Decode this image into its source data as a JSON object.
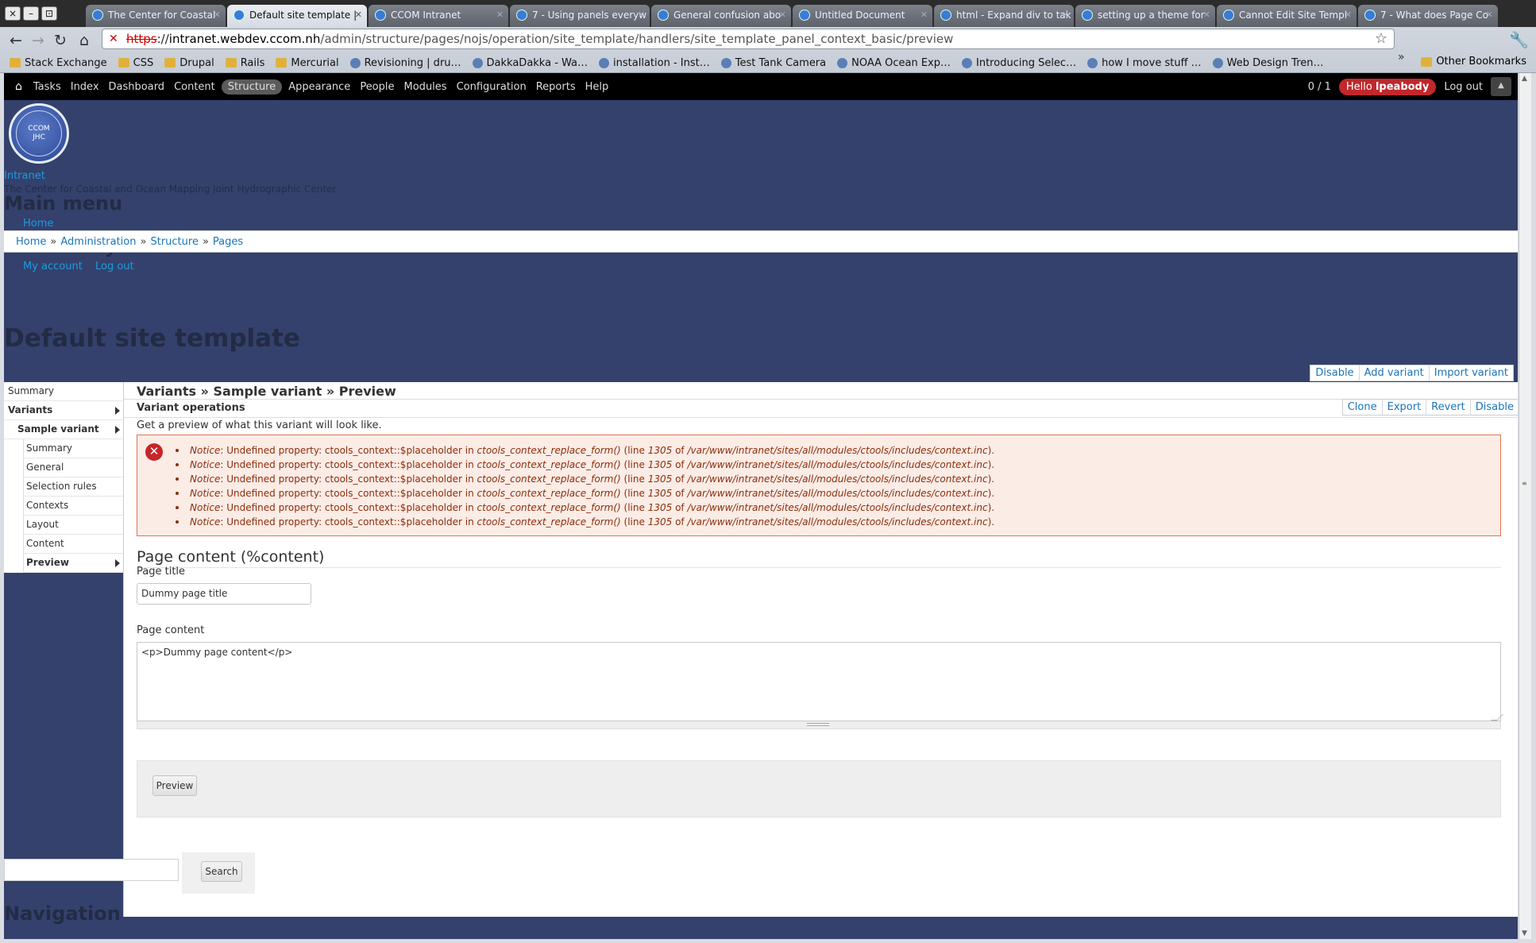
{
  "window": {
    "close": "×",
    "minimize": "–",
    "maximize": "⊡"
  },
  "tabs": [
    {
      "label": "The Center for Coastal",
      "active": false
    },
    {
      "label": "Default site template |",
      "active": true
    },
    {
      "label": "CCOM Intranet",
      "active": false
    },
    {
      "label": "7 - Using panels everyw",
      "active": false
    },
    {
      "label": "General confusion abo",
      "active": false
    },
    {
      "label": "Untitled Document",
      "active": false
    },
    {
      "label": "html - Expand div to tak",
      "active": false
    },
    {
      "label": "setting up a theme for",
      "active": false
    },
    {
      "label": "Cannot Edit Site Templ",
      "active": false
    },
    {
      "label": "7 - What does Page Co",
      "active": false
    }
  ],
  "address": {
    "scheme": "https",
    "domain": "intranet.webdev.ccom.nh",
    "path": "/admin/structure/pages/nojs/operation/site_template/handlers/site_template_panel_context_basic/preview"
  },
  "bookmarks": [
    "Stack Exchange",
    "CSS",
    "Drupal",
    "Rails",
    "Mercurial",
    "Revisioning | dru…",
    "DakkaDakka - Wa…",
    "installation - Inst…",
    "Test Tank Camera",
    "NOAA Ocean Exp…",
    "Introducing Selec…",
    "how I move stuff …",
    "Web Design Tren…"
  ],
  "bookmarks_other": "Other Bookmarks",
  "toolbar": {
    "items": [
      "Tasks",
      "Index",
      "Dashboard",
      "Content",
      "Structure",
      "Appearance",
      "People",
      "Modules",
      "Configuration",
      "Reports",
      "Help"
    ],
    "active": "Structure",
    "counter": "0 / 1",
    "hello_prefix": "Hello",
    "hello_user": "lpeabody",
    "logout": "Log out"
  },
  "header": {
    "logo_text_1": "CCOM",
    "logo_text_2": "JHC",
    "site_name": "Intranet",
    "slogan": "The Center for Coastal and Ocean Mapping Joint Hydrographic Center",
    "main_menu_heading": "Main menu",
    "main_menu_items": [
      "Home"
    ],
    "secondary_menu_heading": "Secondary menu",
    "secondary_menu_items": [
      "My account",
      "Log out"
    ]
  },
  "breadcrumb": [
    "Home",
    "Administration",
    "Structure",
    "Pages"
  ],
  "page_title": "Default site template",
  "top_operations": [
    "Disable",
    "Add variant",
    "Import variant"
  ],
  "vtabs": [
    {
      "label": "Summary",
      "level": 1,
      "bold": false,
      "arrow": false
    },
    {
      "label": "Variants",
      "level": 1,
      "bold": true,
      "arrow": true
    },
    {
      "label": "Sample variant",
      "level": 2,
      "bold": true,
      "arrow": true
    },
    {
      "label": "Summary",
      "level": 3,
      "bold": false,
      "arrow": false
    },
    {
      "label": "General",
      "level": 3,
      "bold": false,
      "arrow": false
    },
    {
      "label": "Selection rules",
      "level": 3,
      "bold": false,
      "arrow": false
    },
    {
      "label": "Contexts",
      "level": 3,
      "bold": false,
      "arrow": false
    },
    {
      "label": "Layout",
      "level": 3,
      "bold": false,
      "arrow": false
    },
    {
      "label": "Content",
      "level": 3,
      "bold": false,
      "arrow": false
    },
    {
      "label": "Preview",
      "level": 3,
      "bold": true,
      "arrow": true
    }
  ],
  "main": {
    "title": "Variants » Sample variant » Preview",
    "variant_ops_label": "Variant operations",
    "variant_ops": [
      "Clone",
      "Export",
      "Revert",
      "Disable"
    ],
    "description": "Get a preview of what this variant will look like.",
    "messages": [
      {
        "prefix": "Notice",
        "text": "Undefined property: ctools_context::$placeholder in",
        "func": "ctools_context_replace_form()",
        "line_pre": "(line",
        "line": "1305",
        "of": "of",
        "file": "/var/www/intranet/sites/all/modules/ctools/includes/context.inc",
        "end": ")."
      },
      {
        "prefix": "Notice",
        "text": "Undefined property: ctools_context::$placeholder in",
        "func": "ctools_context_replace_form()",
        "line_pre": "(line",
        "line": "1305",
        "of": "of",
        "file": "/var/www/intranet/sites/all/modules/ctools/includes/context.inc",
        "end": ")."
      },
      {
        "prefix": "Notice",
        "text": "Undefined property: ctools_context::$placeholder in",
        "func": "ctools_context_replace_form()",
        "line_pre": "(line",
        "line": "1305",
        "of": "of",
        "file": "/var/www/intranet/sites/all/modules/ctools/includes/context.inc",
        "end": ")."
      },
      {
        "prefix": "Notice",
        "text": "Undefined property: ctools_context::$placeholder in",
        "func": "ctools_context_replace_form()",
        "line_pre": "(line",
        "line": "1305",
        "of": "of",
        "file": "/var/www/intranet/sites/all/modules/ctools/includes/context.inc",
        "end": ")."
      },
      {
        "prefix": "Notice",
        "text": "Undefined property: ctools_context::$placeholder in",
        "func": "ctools_context_replace_form()",
        "line_pre": "(line",
        "line": "1305",
        "of": "of",
        "file": "/var/www/intranet/sites/all/modules/ctools/includes/context.inc",
        "end": ")."
      },
      {
        "prefix": "Notice",
        "text": "Undefined property: ctools_context::$placeholder in",
        "func": "ctools_context_replace_form()",
        "line_pre": "(line",
        "line": "1305",
        "of": "of",
        "file": "/var/www/intranet/sites/all/modules/ctools/includes/context.inc",
        "end": ")."
      }
    ],
    "section_title": "Page content (%content)",
    "page_title_label": "Page title",
    "page_title_value": "Dummy page title",
    "page_content_label": "Page content",
    "page_content_value": "<p>Dummy page content</p>",
    "preview_button": "Preview"
  },
  "search": {
    "value": "",
    "button": "Search"
  },
  "navigation_heading": "Navigation",
  "colors": {
    "page_bg": "#33416c",
    "link": "#1b74b8",
    "error_bg": "#fcece6",
    "error_border": "#e0734e",
    "error_text": "#8c2e0b",
    "hello_badge": "#c0282c"
  }
}
